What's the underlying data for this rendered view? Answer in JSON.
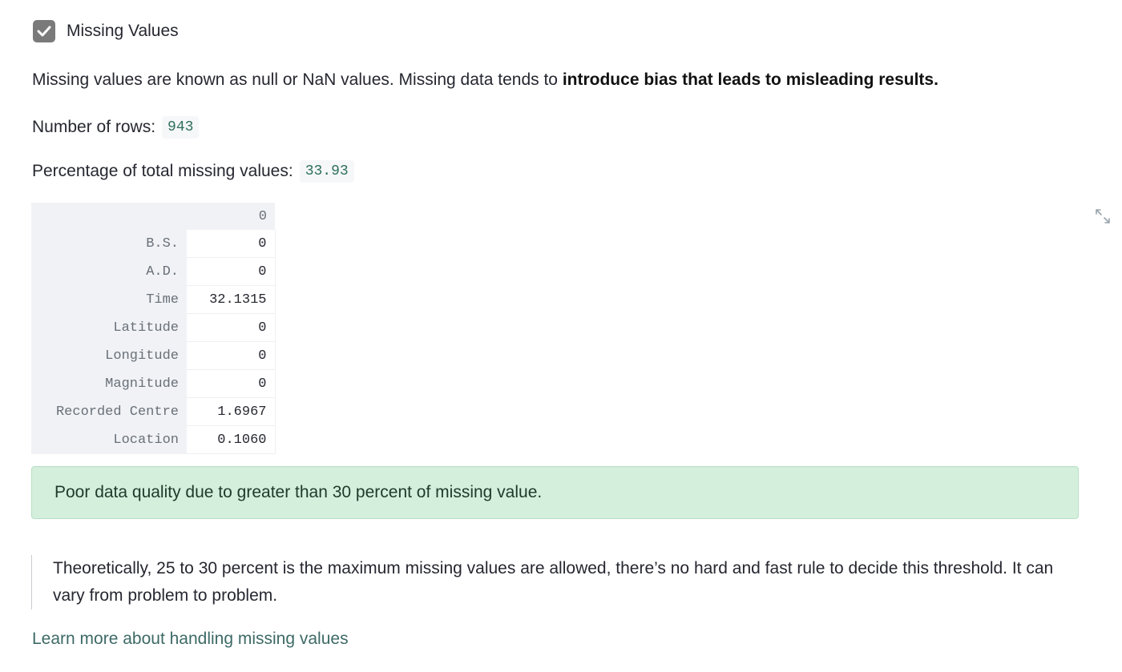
{
  "checkbox": {
    "label": "Missing Values",
    "checked": true,
    "icon": "check-icon"
  },
  "intro": {
    "text": "Missing values are known as null or NaN values. Missing data tends to ",
    "bold": "introduce bias that leads to misleading results."
  },
  "stats": {
    "rows_label": "Number of rows:",
    "rows_value": "943",
    "missing_label": "Percentage of total missing values:",
    "missing_value": "33.93"
  },
  "table": {
    "column_header": "0",
    "rows": [
      {
        "label": "B.S.",
        "value": "0"
      },
      {
        "label": "A.D.",
        "value": "0"
      },
      {
        "label": "Time",
        "value": "32.1315"
      },
      {
        "label": "Latitude",
        "value": "0"
      },
      {
        "label": "Longitude",
        "value": "0"
      },
      {
        "label": "Magnitude",
        "value": "0"
      },
      {
        "label": "Recorded Centre",
        "value": "1.6967"
      },
      {
        "label": "Location",
        "value": "0.1060"
      }
    ]
  },
  "expand_icon": "fullscreen-expand-icon",
  "alert": {
    "text": "Poor data quality due to greater than 30 percent of missing value.",
    "color": "#d4efdc"
  },
  "quote": {
    "text": "Theoretically, 25 to 30 percent is the maximum missing values are allowed, there’s no hard and fast rule to decide this threshold. It can vary from problem to problem."
  },
  "link": {
    "text": "Learn more about handling missing values"
  }
}
